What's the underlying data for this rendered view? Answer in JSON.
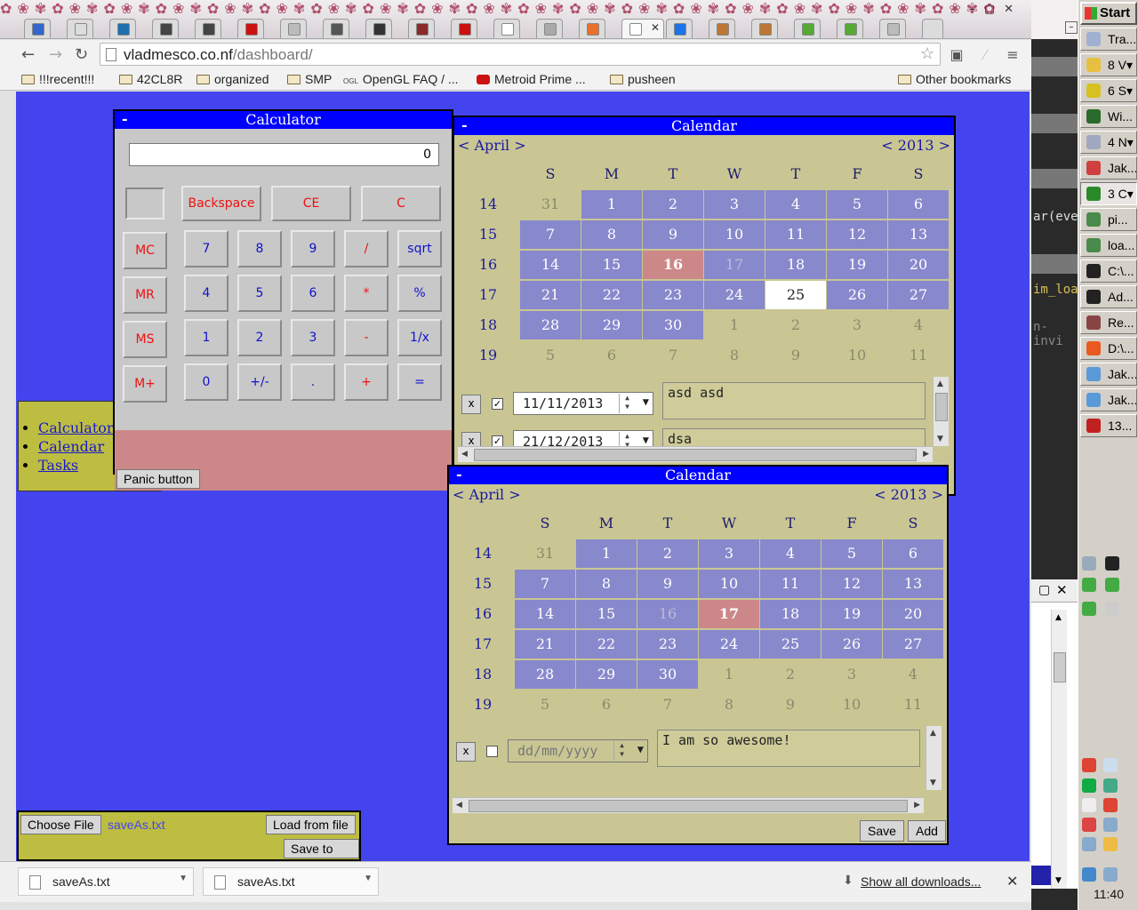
{
  "browser": {
    "url_host": "vladmesco.co.nf",
    "url_path": "/dashboard/",
    "bookmarks": [
      "!!!recent!!!",
      "42CL8R",
      "organized",
      "SMP",
      "OpenGL FAQ / ...",
      "Metroid Prime ...",
      "pusheen"
    ],
    "other_bookmarks": "Other bookmarks"
  },
  "calculator": {
    "title": "Calculator",
    "display": "0",
    "row1": [
      "Backspace",
      "CE",
      "C"
    ],
    "memory": [
      "MC",
      "MR",
      "MS",
      "M+"
    ],
    "keys": [
      [
        "7",
        "8",
        "9",
        "/",
        "sqrt"
      ],
      [
        "4",
        "5",
        "6",
        "*",
        "%"
      ],
      [
        "1",
        "2",
        "3",
        "-",
        "1/x"
      ],
      [
        "0",
        "+/-",
        ".",
        "+",
        "="
      ]
    ],
    "panic_label": "Panic button"
  },
  "nav": {
    "items": [
      "Calculator",
      "Calendar",
      "Tasks"
    ]
  },
  "weekdays": [
    "S",
    "M",
    "T",
    "W",
    "T",
    "F",
    "S"
  ],
  "weeks": [
    "14",
    "15",
    "16",
    "17",
    "18",
    "19"
  ],
  "calendar1": {
    "title": "Calendar",
    "month_label": "< April >",
    "year_label": "< 2013 >",
    "days": [
      [
        "31",
        "1",
        "2",
        "3",
        "4",
        "5",
        "6"
      ],
      [
        "7",
        "8",
        "9",
        "10",
        "11",
        "12",
        "13"
      ],
      [
        "14",
        "15",
        "16",
        "17",
        "18",
        "19",
        "20"
      ],
      [
        "21",
        "22",
        "23",
        "24",
        "25",
        "26",
        "27"
      ],
      [
        "28",
        "29",
        "30",
        "1",
        "2",
        "3",
        "4"
      ],
      [
        "5",
        "6",
        "7",
        "8",
        "9",
        "10",
        "11"
      ]
    ],
    "tasks": [
      {
        "remove": "x",
        "checked": "✓",
        "date": "11/11/2013",
        "text": "asd asd"
      },
      {
        "remove": "x",
        "checked": "✓",
        "date": "21/12/2013",
        "text": "dsa"
      }
    ]
  },
  "calendar2": {
    "title": "Calendar",
    "month_label": "< April >",
    "year_label": "< 2013 >",
    "days": [
      [
        "31",
        "1",
        "2",
        "3",
        "4",
        "5",
        "6"
      ],
      [
        "7",
        "8",
        "9",
        "10",
        "11",
        "12",
        "13"
      ],
      [
        "14",
        "15",
        "16",
        "17",
        "18",
        "19",
        "20"
      ],
      [
        "21",
        "22",
        "23",
        "24",
        "25",
        "26",
        "27"
      ],
      [
        "28",
        "29",
        "30",
        "1",
        "2",
        "3",
        "4"
      ],
      [
        "5",
        "6",
        "7",
        "8",
        "9",
        "10",
        "11"
      ]
    ],
    "task": {
      "remove": "x",
      "date_placeholder": "dd/mm/yyyy",
      "text": "I am so awesome!"
    },
    "save_label": "Save",
    "add_label": "Add"
  },
  "filebox": {
    "choose_label": "Choose File",
    "file_name": "saveAs.txt",
    "load_label": "Load from file",
    "save_label": "Save to file"
  },
  "downloads": {
    "items": [
      "saveAs.txt",
      "saveAs.txt"
    ],
    "show_all": "Show all downloads..."
  },
  "taskbar": {
    "start": "Start",
    "tasks": [
      "Tra...",
      "8 V▾",
      "6 S▾",
      "Wi...",
      "4 N▾",
      "Jak...",
      "3 C▾",
      "pi...",
      "loa...",
      "C:\\...",
      "Ad...",
      "Re...",
      "D:\\...",
      "Jak...",
      "Jak...",
      "13..."
    ],
    "clock": "11:40"
  },
  "background_fragments": [
    "ar(eve",
    "im_loa",
    "n-invi"
  ],
  "colors": {
    "page_bg": "#4444ee",
    "title_bar": "#0000ff",
    "calendar_bg": "#c9c694",
    "current_month_cell": "#8888cc",
    "highlight_cell": "#cc8888",
    "panel_yellow": "#bdbd42"
  }
}
